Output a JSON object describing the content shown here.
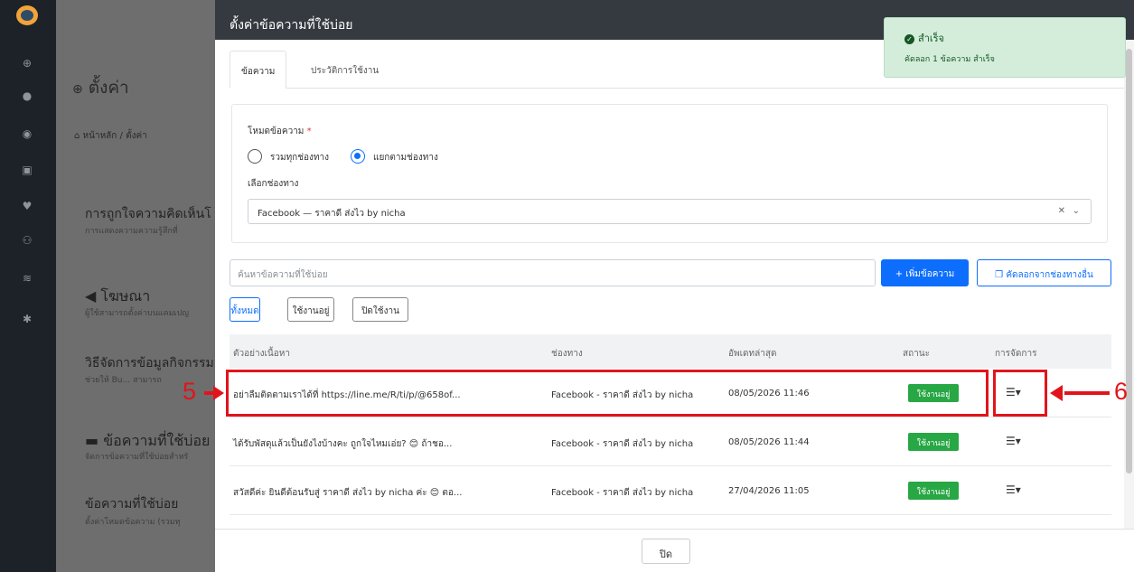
{
  "background": {
    "title": "ตั้งค่า",
    "breadcrumb": "หน้าหลัก / ตั้งค่า",
    "sections": [
      {
        "title": "การถูกใจความคิดเห็นโ",
        "sub": "การแสดงความความรู้สึกที่"
      },
      {
        "title": "โฆษณา",
        "sub": "ผู้ใช้สามารถตั้งค่าบนแคมเปญ"
      },
      {
        "title": "วิธีจัดการข้อมูลกิจกรรม",
        "sub": "ช่วยให้ Bu... สามารถ"
      },
      {
        "title": "ข้อความที่ใช้บ่อย",
        "sub": "จัดการข้อความที่ใช้บ่อยสำหรั"
      },
      {
        "title": "ข้อความที่ใช้บ่อย",
        "sub": "ตั้งค่าโหมดข้อความ (รวมทุ"
      }
    ]
  },
  "modal": {
    "title": "ตั้งค่าข้อความที่ใช้บ่อย",
    "tabs": [
      "ข้อความ",
      "ประวัติการใช้งาน"
    ],
    "mode_label": "โหมดข้อความ",
    "required_mark": "*",
    "radio_all": "รวมทุกช่องทาง",
    "radio_split": "แยกตามช่องทาง",
    "channel_label": "เลือกช่องทาง",
    "channel_value": "Facebook — ราคาดี ส่งไว by nicha",
    "search_placeholder": "ค้นหาข้อความที่ใช้บ่อย",
    "add_button": "+ เพิ่มข้อความ",
    "copy_button": "คัดลอกจากช่องทางอื่น",
    "filters": [
      "ทั้งหมด",
      "ใช้งานอยู่",
      "ปิดใช้งาน"
    ],
    "columns": [
      "ตัวอย่างเนื้อหา",
      "ช่องทาง",
      "อัพเดทล่าสุด",
      "สถานะ",
      "การจัดการ"
    ],
    "rows": [
      {
        "content": "อย่าลืมติดตามเราได้ที่ https://line.me/R/ti/p/@658of...",
        "channel": "Facebook - ราคาดี ส่งไว by nicha",
        "updated": "08/05/2026 11:46",
        "status": "ใช้งานอยู่"
      },
      {
        "content": "ได้รับพัสดุแล้วเป็นยังไงบ้างคะ ถูกใจไหมเอ่ย? 😊 ถ้าชอ...",
        "channel": "Facebook - ราคาดี ส่งไว by nicha",
        "updated": "08/05/2026 11:44",
        "status": "ใช้งานอยู่"
      },
      {
        "content": "สวัสดีค่ะ ยินดีต้อนรับสู่ ราคาดี ส่งไว by nicha ค่ะ 😊 ตอ...",
        "channel": "Facebook - ราคาดี ส่งไว by nicha",
        "updated": "27/04/2026 11:05",
        "status": "ใช้งานอยู่"
      }
    ],
    "close_button": "ปิด"
  },
  "toast": {
    "title": "สำเร็จ",
    "message": "คัดลอก 1 ข้อความ สำเร็จ"
  },
  "annotations": {
    "left_number": "5",
    "right_number": "6"
  },
  "colors": {
    "primary": "#0d6efd",
    "success": "#28a745",
    "annotation": "#e2141b",
    "header": "#343a40"
  }
}
